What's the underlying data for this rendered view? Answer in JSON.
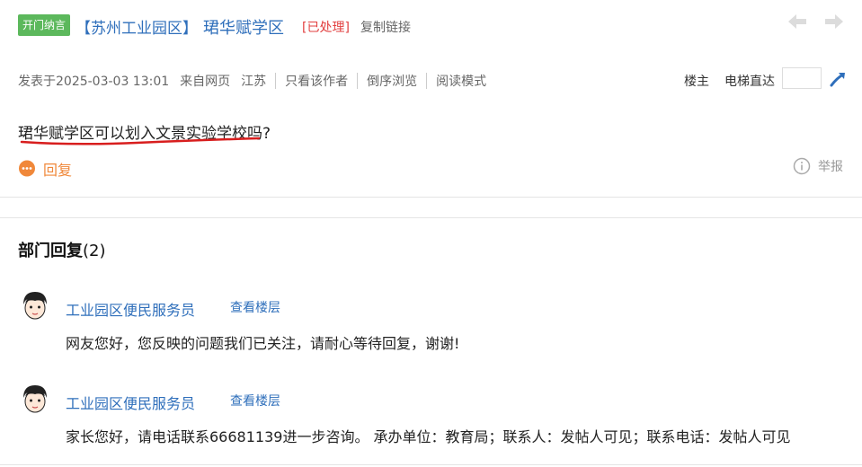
{
  "header": {
    "tag": "开门纳言",
    "forum": "【苏州工业园区】",
    "title": "珺华赋学区",
    "status": "[已处理]",
    "copy_link": "复制链接"
  },
  "meta": {
    "posted": "发表于2025-03-03 13:01",
    "source": "来自网页",
    "region": "江苏",
    "only_author": "只看该作者",
    "reverse": "倒序浏览",
    "reading_mode": "阅读模式",
    "louzhu": "楼主",
    "elevator": "电梯直达",
    "floor_value": ""
  },
  "post": {
    "question": "珺华赋学区可以划入文景实验学校吗?",
    "reply_label": "回复",
    "report_label": "举报"
  },
  "replies": {
    "heading": "部门回复",
    "count": "(2)",
    "items": [
      {
        "dept": "工业园区便民服务员",
        "view_floor": "查看楼层",
        "text": "网友您好，您反映的问题我们已关注，请耐心等待回复，谢谢!"
      },
      {
        "dept": "工业园区便民服务员",
        "view_floor": "查看楼层",
        "text": "家长您好，请电话联系66681139进一步咨询。 承办单位：教育局；联系人：发帖人可见；联系电话：发帖人可见"
      }
    ]
  },
  "colors": {
    "link": "#2f6fbb",
    "tag_bg": "#5cb85c",
    "status": "#e24040",
    "reply_orange": "#f0883a",
    "underline_red": "#d81e1e"
  },
  "icons": {
    "prev": "arrow-left-icon",
    "next": "arrow-right-icon",
    "go": "go-floor-icon",
    "reply": "chat-bubble-icon",
    "report": "info-circle-icon",
    "avatar": "cartoon-avatar"
  }
}
